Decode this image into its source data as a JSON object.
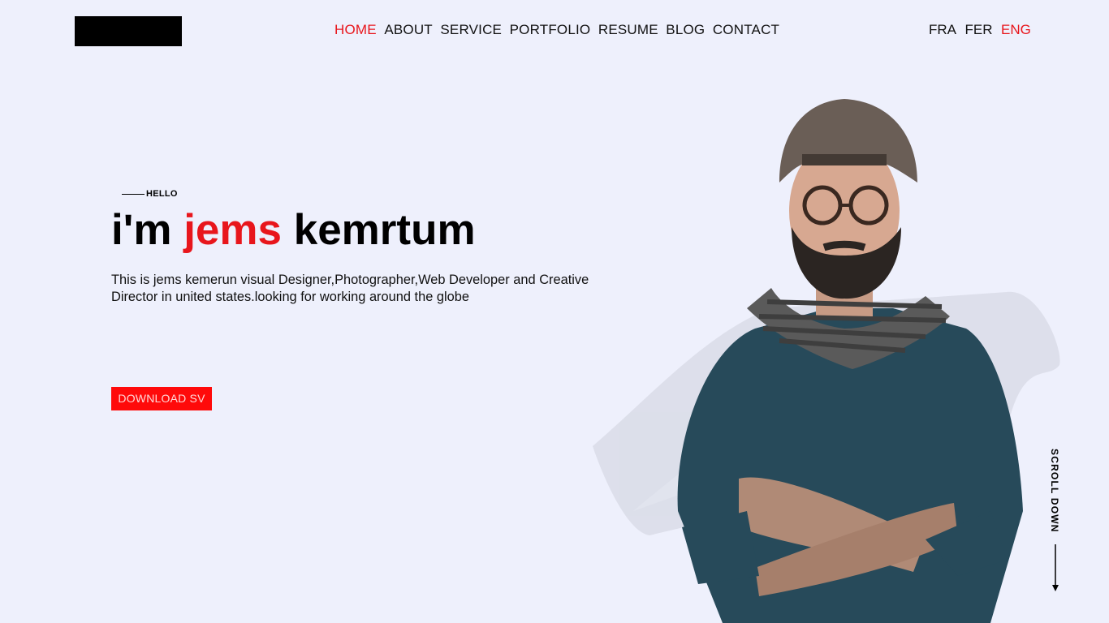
{
  "nav": {
    "items": [
      {
        "label": "HOME",
        "active": true
      },
      {
        "label": "ABOUT",
        "active": false
      },
      {
        "label": "SERVICE",
        "active": false
      },
      {
        "label": "PORTFOLIO",
        "active": false
      },
      {
        "label": "RESUME",
        "active": false
      },
      {
        "label": "BLOG",
        "active": false
      },
      {
        "label": "CONTACT",
        "active": false
      }
    ]
  },
  "languages": {
    "items": [
      {
        "label": "FRA",
        "active": false
      },
      {
        "label": "FER",
        "active": false
      },
      {
        "label": "ENG",
        "active": true
      }
    ]
  },
  "hero": {
    "kicker": "HELLO",
    "headline_prefix": "i'm ",
    "headline_highlight": "jems",
    "headline_suffix": " kemrtum",
    "description": "This is jems kemerun visual Designer,Photographer,Web Developer and Creative Director in united states.looking for working around the globe",
    "cta_label": "DOWNLOAD SV"
  },
  "scroll": {
    "label": "SCROLL DOWN"
  },
  "colors": {
    "accent": "#e8161c",
    "background": "#eef0fc",
    "button": "#ff0a0a"
  }
}
